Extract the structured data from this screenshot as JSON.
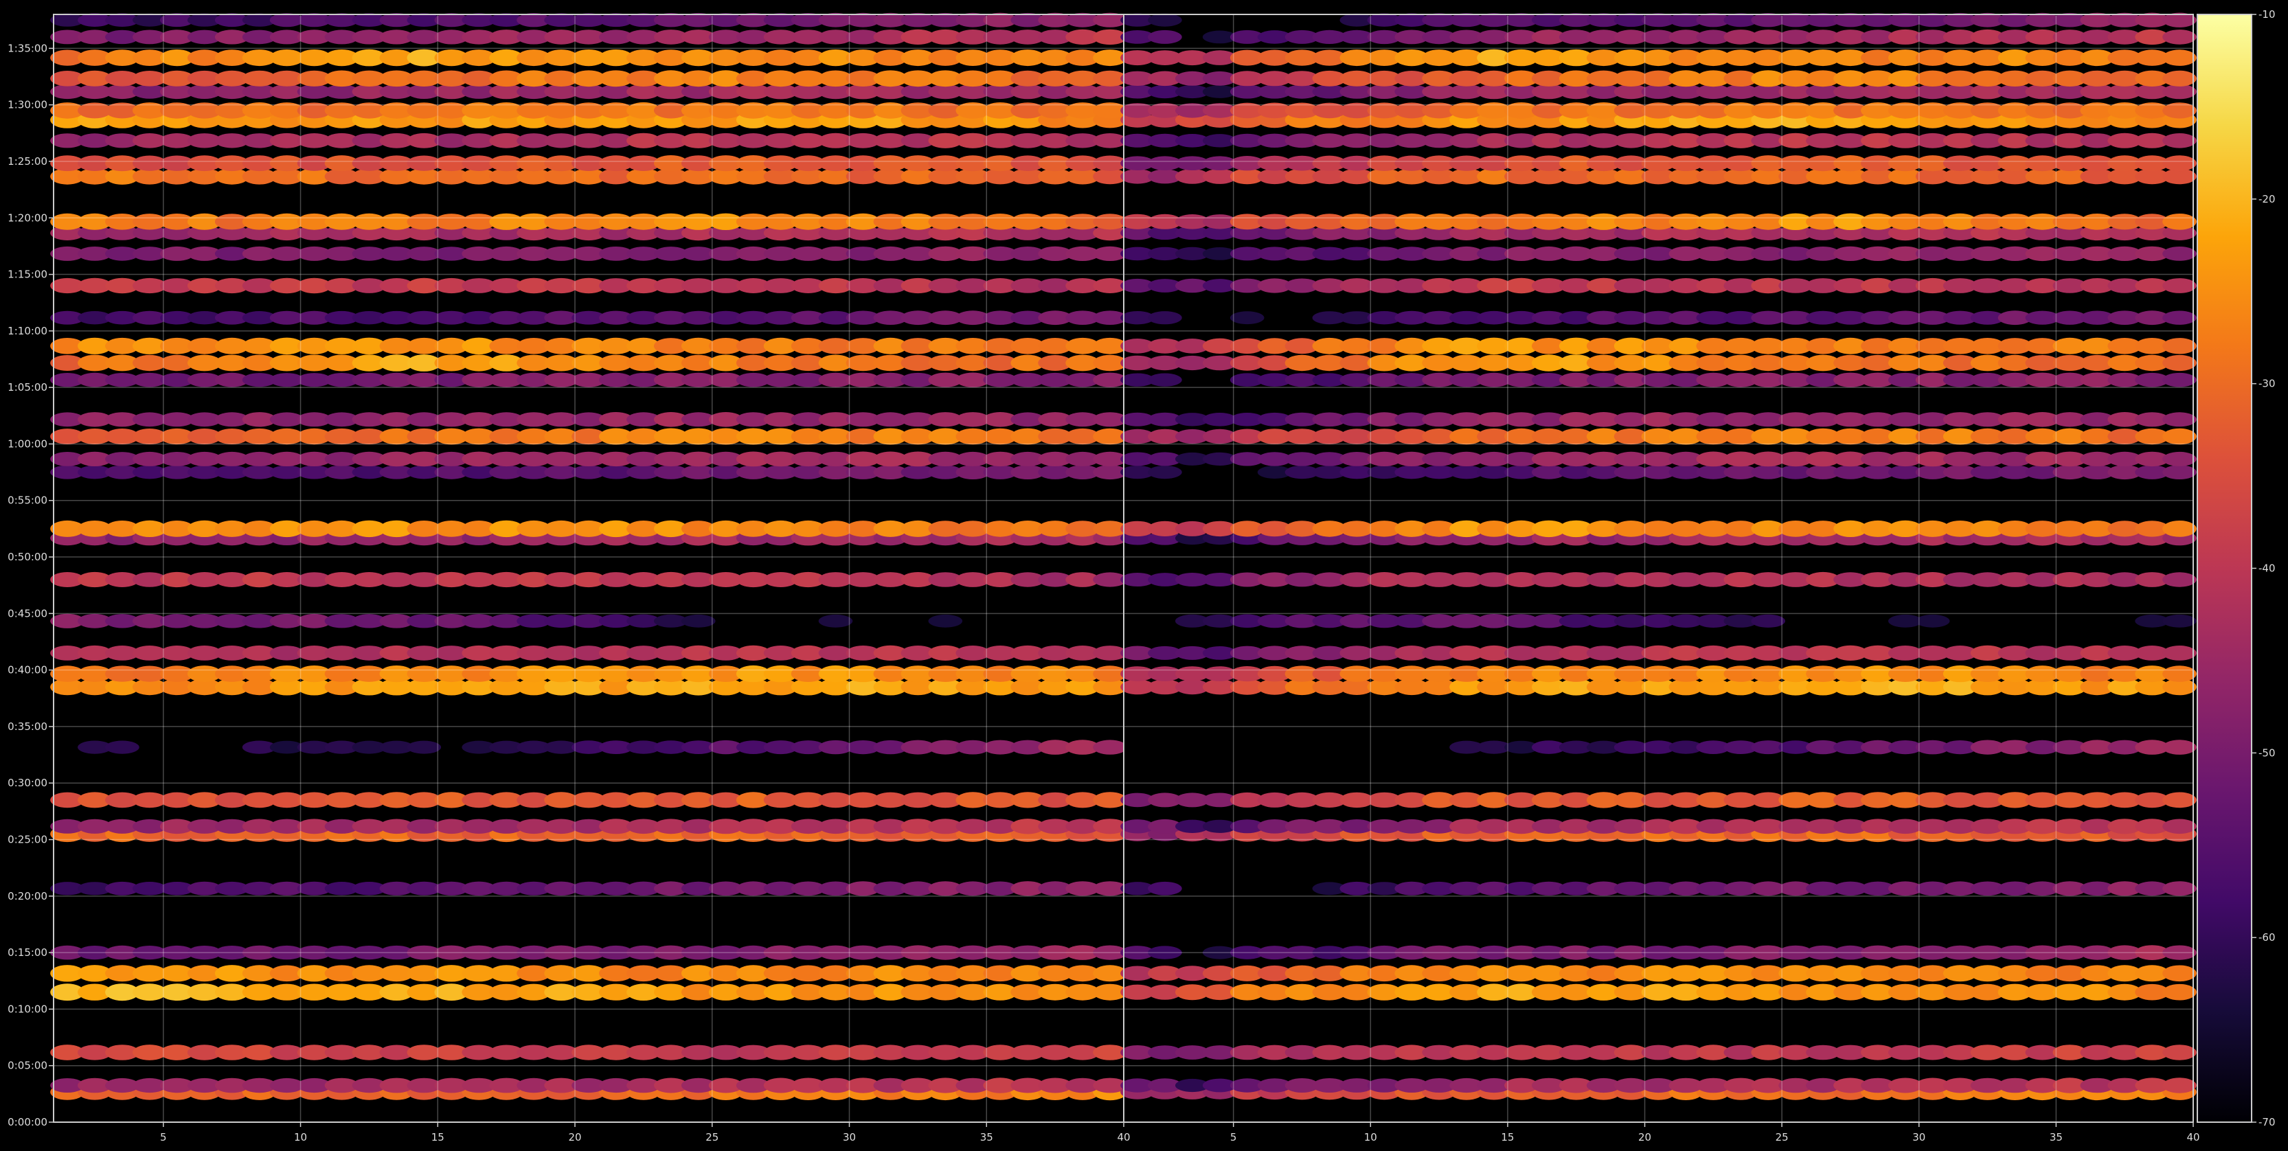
{
  "chart_data": {
    "type": "heatmap",
    "title": "",
    "xlabel": "",
    "ylabel": "",
    "panels": [
      {
        "name": "",
        "xlim": [
          1,
          40
        ],
        "x_ticks": [
          "5",
          "10",
          "15",
          "20",
          "25",
          "30",
          "35",
          "40"
        ]
      },
      {
        "name": "",
        "xlim": [
          1,
          40
        ],
        "x_ticks": [
          "5",
          "10",
          "15",
          "20",
          "25",
          "30",
          "35",
          "40"
        ]
      }
    ],
    "x_columns": 39,
    "ylim": [
      "0:00:00",
      "1:38:00"
    ],
    "y_ticks": [
      "0:00:00",
      "0:05:00",
      "0:10:00",
      "0:15:00",
      "0:20:00",
      "0:25:00",
      "0:30:00",
      "0:35:00",
      "0:40:00",
      "0:45:00",
      "0:50:00",
      "0:55:00",
      "1:00:00",
      "1:05:00",
      "1:10:00",
      "1:15:00",
      "1:20:00",
      "1:25:00",
      "1:30:00",
      "1:35:00"
    ],
    "grid": true,
    "colormap": "inferno",
    "colorbar": {
      "min": -70,
      "max": -10,
      "ticks": [
        "-10",
        "-20",
        "-30",
        "-40",
        "-50",
        "-60",
        "-70"
      ]
    },
    "bands": [
      {
        "t": "0:02:40",
        "values": [
          -32,
          -31,
          -29,
          -26,
          -44
        ]
      },
      {
        "t": "0:03:15",
        "values": [
          -45,
          -44,
          -42,
          -40,
          -52
        ]
      },
      {
        "t": "0:06:10",
        "values": [
          -36,
          -38,
          -40,
          -36,
          -50
        ]
      },
      {
        "t": "0:11:30",
        "values": [
          -20,
          -22,
          -24,
          -26,
          -38
        ]
      },
      {
        "t": "0:13:10",
        "values": [
          -24,
          -25,
          -26,
          -27,
          -40
        ]
      },
      {
        "t": "0:15:00",
        "values": [
          -52,
          -50,
          -48,
          -44,
          -56
        ]
      },
      {
        "t": "0:20:40",
        "values": [
          -58,
          -55,
          -50,
          -47,
          -60
        ]
      },
      {
        "t": "0:25:30",
        "values": [
          -30,
          -31,
          -30,
          -34,
          -48
        ]
      },
      {
        "t": "0:26:10",
        "values": [
          -46,
          -44,
          -42,
          -40,
          -52
        ]
      },
      {
        "t": "0:28:30",
        "values": [
          -33,
          -33,
          -32,
          -34,
          -50
        ]
      },
      {
        "t": "0:33:10",
        "values": [
          -64,
          -62,
          -54,
          -44,
          -66
        ]
      },
      {
        "t": "0:38:30",
        "values": [
          -26,
          -23,
          -21,
          -24,
          -38
        ]
      },
      {
        "t": "0:39:40",
        "values": [
          -28,
          -26,
          -24,
          -27,
          -40
        ]
      },
      {
        "t": "0:41:30",
        "values": [
          -42,
          -42,
          -40,
          -42,
          -52
        ]
      },
      {
        "t": "0:44:20",
        "values": [
          -48,
          -52,
          -66,
          -66,
          -70
        ]
      },
      {
        "t": "0:48:00",
        "values": [
          -40,
          -40,
          -41,
          -44,
          -54
        ]
      },
      {
        "t": "0:51:40",
        "values": [
          -48,
          -46,
          -44,
          -44,
          -56
        ]
      },
      {
        "t": "0:52:30",
        "values": [
          -26,
          -24,
          -26,
          -28,
          -40
        ]
      },
      {
        "t": "0:57:30",
        "values": [
          -58,
          -56,
          -52,
          -50,
          -62
        ]
      },
      {
        "t": "0:58:40",
        "values": [
          -47,
          -46,
          -44,
          -45,
          -56
        ]
      },
      {
        "t": "1:00:40",
        "values": [
          -32,
          -30,
          -26,
          -30,
          -44
        ]
      },
      {
        "t": "1:02:10",
        "values": [
          -48,
          -46,
          -45,
          -46,
          -56
        ]
      },
      {
        "t": "1:05:40",
        "values": [
          -52,
          -50,
          -48,
          -48,
          -58
        ]
      },
      {
        "t": "1:07:10",
        "values": [
          -30,
          -22,
          -28,
          -30,
          -42
        ]
      },
      {
        "t": "1:08:40",
        "values": [
          -26,
          -24,
          -27,
          -28,
          -40
        ]
      },
      {
        "t": "1:11:10",
        "values": [
          -58,
          -56,
          -54,
          -50,
          -62
        ]
      },
      {
        "t": "1:14:00",
        "values": [
          -40,
          -39,
          -40,
          -42,
          -54
        ]
      },
      {
        "t": "1:16:50",
        "values": [
          -50,
          -49,
          -48,
          -46,
          -58
        ]
      },
      {
        "t": "1:18:40",
        "values": [
          -44,
          -44,
          -42,
          -42,
          -54
        ]
      },
      {
        "t": "1:19:40",
        "values": [
          -28,
          -28,
          -24,
          -30,
          -40
        ]
      },
      {
        "t": "1:23:40",
        "values": [
          -28,
          -30,
          -30,
          -32,
          -44
        ]
      },
      {
        "t": "1:24:50",
        "values": [
          -36,
          -34,
          -32,
          -34,
          -48
        ]
      },
      {
        "t": "1:26:50",
        "values": [
          -46,
          -44,
          -40,
          -42,
          -54
        ]
      },
      {
        "t": "1:28:40",
        "values": [
          -22,
          -24,
          -22,
          -26,
          -40
        ]
      },
      {
        "t": "1:29:30",
        "values": [
          -30,
          -29,
          -28,
          -30,
          -44
        ]
      },
      {
        "t": "1:31:10",
        "values": [
          -48,
          -46,
          -44,
          -44,
          -56
        ]
      },
      {
        "t": "1:32:20",
        "values": [
          -34,
          -30,
          -26,
          -30,
          -44
        ]
      },
      {
        "t": "1:34:10",
        "values": [
          -28,
          -22,
          -26,
          -26,
          -40
        ]
      },
      {
        "t": "1:36:00",
        "values": [
          -50,
          -46,
          -44,
          -40,
          -54
        ]
      },
      {
        "t": "1:37:30",
        "values": [
          -60,
          -56,
          -52,
          -46,
          -62
        ]
      }
    ]
  }
}
